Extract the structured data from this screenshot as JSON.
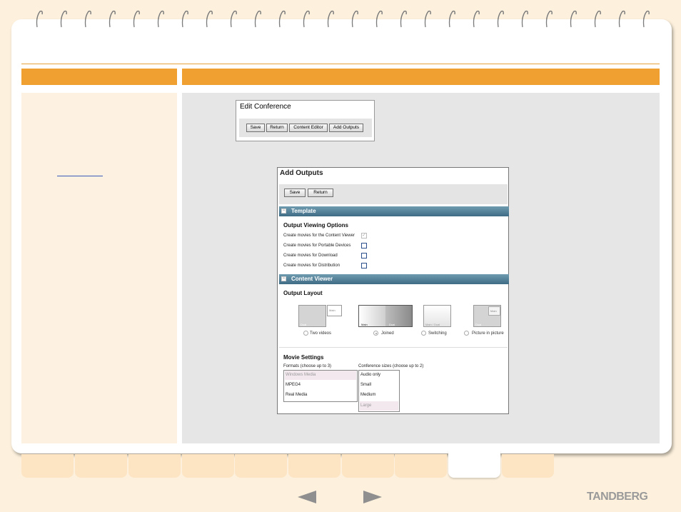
{
  "edit_conference": {
    "title": "Edit Conference",
    "buttons": [
      "Save",
      "Return",
      "Content Editor",
      "Add Outputs"
    ]
  },
  "add_outputs": {
    "title": "Add Outputs",
    "buttons": [
      "Save",
      "Return"
    ],
    "template_section": "Template",
    "output_viewing": {
      "heading": "Output Viewing Options",
      "options": [
        {
          "label": "Create movies for the Content Viewer",
          "checked": true,
          "disabled": true
        },
        {
          "label": "Create movies for Portable Devices",
          "checked": false,
          "disabled": false
        },
        {
          "label": "Create movies for Download",
          "checked": false,
          "disabled": false
        },
        {
          "label": "Create movies for Distribution",
          "checked": false,
          "disabled": false
        }
      ]
    },
    "content_viewer_section": "Content Viewer",
    "output_layout": {
      "heading": "Output Layout",
      "thumb_labels": {
        "two_videos_main": "Main",
        "two_videos_dual": "Dual",
        "joined_main": "Main",
        "joined_dual": "Dual",
        "switching": "Main / Dual",
        "pip_main": "Main",
        "pip_dual": "Dual"
      },
      "options": [
        "Two videos",
        "Joined",
        "Switching",
        "Picture in picture"
      ],
      "selected": "Joined"
    },
    "movie_settings": {
      "heading": "Movie Settings",
      "formats_label": "Formats (choose up to 3)",
      "formats": [
        "Windows Media",
        "MPEG4",
        "Real Media"
      ],
      "sizes_label": "Conference sizes (choose up to 2)",
      "sizes": [
        "Audio only",
        "Small",
        "Medium",
        "Large"
      ]
    }
  },
  "branding": {
    "logo": "TANDBERG"
  },
  "colors": {
    "accent": "#f0a030",
    "section_bar": "#4f7d95",
    "page_bg": "#fdf1dd"
  }
}
